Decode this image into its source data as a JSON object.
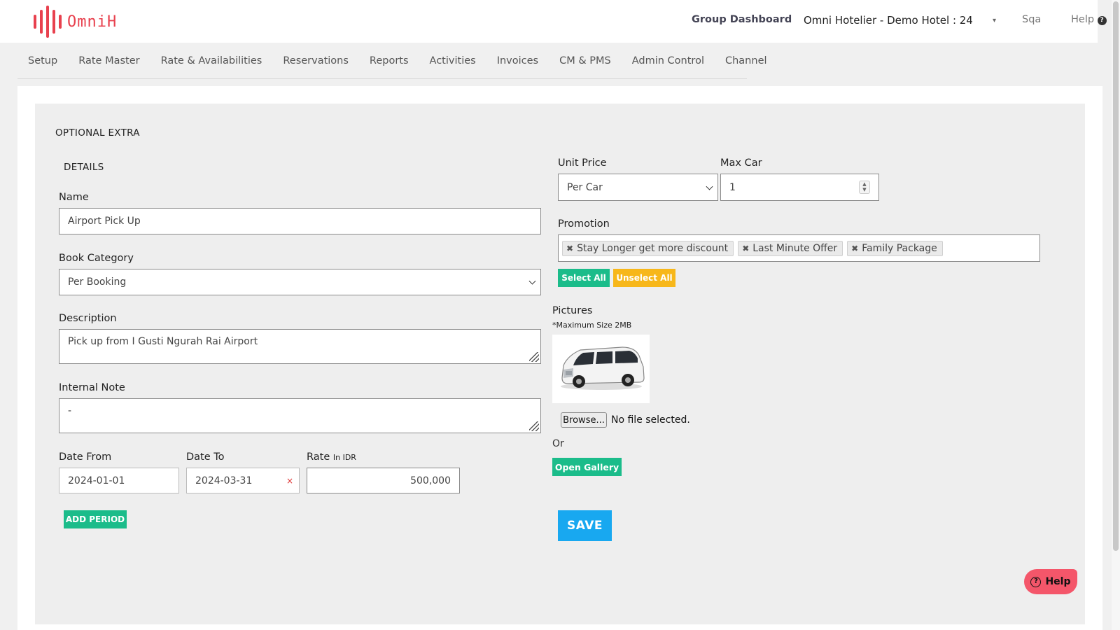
{
  "brand": {
    "name": "OmniH",
    "color": "#e8414e"
  },
  "header": {
    "group_dashboard": "Group Dashboard",
    "hotel": "Omni Hotelier - Demo Hotel : 24",
    "caret": "▾",
    "user": "Sqa",
    "help": "Help",
    "help_icon": "?"
  },
  "nav": [
    "Setup",
    "Rate Master",
    "Rate & Availabilities",
    "Reservations",
    "Reports",
    "Activities",
    "Invoices",
    "CM & PMS",
    "Admin Control",
    "Channel"
  ],
  "form": {
    "section_title": "OPTIONAL EXTRA",
    "details_title": "DETAILS",
    "name": {
      "label": "Name",
      "value": "Airport Pick Up"
    },
    "book_category": {
      "label": "Book Category",
      "value": "Per Booking"
    },
    "description": {
      "label": "Description",
      "value": "Pick up from I Gusti Ngurah Rai Airport"
    },
    "internal_note": {
      "label": "Internal Note",
      "value": "-"
    },
    "date_from": {
      "label": "Date From",
      "value": "2024-01-01"
    },
    "date_to": {
      "label": "Date To",
      "value": "2024-03-31",
      "clear": "×"
    },
    "rate": {
      "label": "Rate",
      "unit": "In IDR",
      "value": "500,000"
    },
    "add_period": "ADD PERIOD",
    "unit_price": {
      "label": "Unit Price",
      "value": "Per Car"
    },
    "max_car": {
      "label": "Max Car",
      "value": "1"
    },
    "promotion": {
      "label": "Promotion",
      "tags": [
        "Stay Longer get more discount",
        "Last Minute Offer",
        "Family Package"
      ],
      "select_all": "Select All",
      "unselect_all": "Unselect All"
    },
    "pictures": {
      "label": "Pictures",
      "note": "*Maximum Size 2MB",
      "browse": "Browse...",
      "no_file": "No file selected.",
      "or": "Or",
      "open_gallery": "Open Gallery"
    },
    "save": "SAVE"
  },
  "help_button": "Help",
  "colors": {
    "green": "#1bbc8a",
    "yellow": "#f7b71a",
    "blue": "#18a8f0",
    "help": "#f4566a"
  }
}
